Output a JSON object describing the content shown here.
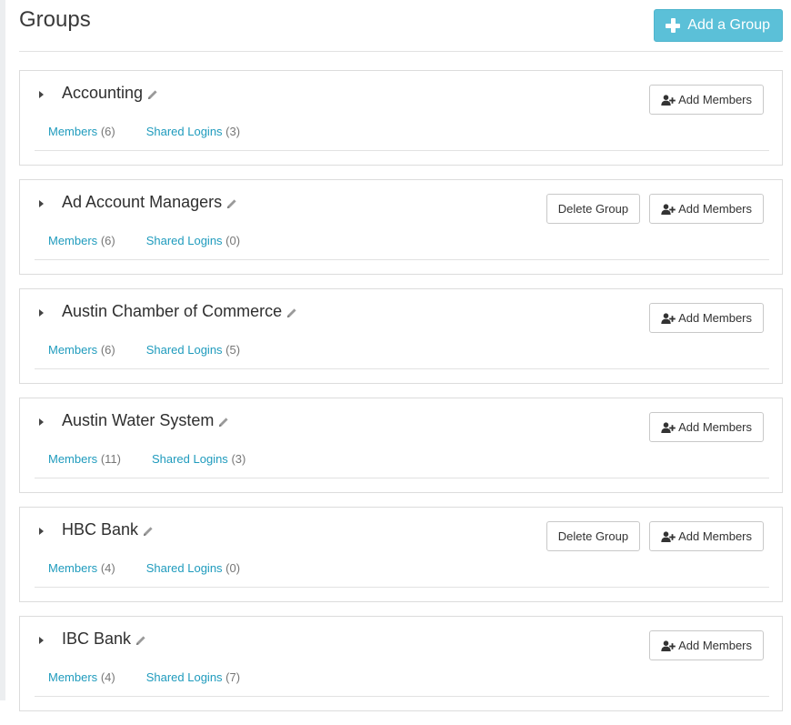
{
  "page": {
    "title": "Groups",
    "add_group_label": "Add a Group"
  },
  "groups": [
    {
      "name": "Accounting",
      "members_label": "Members",
      "members_count": "(6)",
      "logins_label": "Shared Logins",
      "logins_count": "(3)",
      "delete_label": "",
      "add_members_label": "Add Members"
    },
    {
      "name": "Ad Account Managers",
      "members_label": "Members",
      "members_count": "(6)",
      "logins_label": "Shared Logins",
      "logins_count": "(0)",
      "delete_label": "Delete Group",
      "add_members_label": "Add Members"
    },
    {
      "name": "Austin Chamber of Commerce",
      "members_label": "Members",
      "members_count": "(6)",
      "logins_label": "Shared Logins",
      "logins_count": "(5)",
      "delete_label": "",
      "add_members_label": "Add Members"
    },
    {
      "name": "Austin Water System",
      "members_label": "Members",
      "members_count": "(11)",
      "logins_label": "Shared Logins",
      "logins_count": "(3)",
      "delete_label": "",
      "add_members_label": "Add Members"
    },
    {
      "name": "HBC Bank",
      "members_label": "Members",
      "members_count": "(4)",
      "logins_label": "Shared Logins",
      "logins_count": "(0)",
      "delete_label": "Delete Group",
      "add_members_label": "Add Members"
    },
    {
      "name": "IBC Bank",
      "members_label": "Members",
      "members_count": "(4)",
      "logins_label": "Shared Logins",
      "logins_count": "(7)",
      "delete_label": "",
      "add_members_label": "Add Members"
    }
  ],
  "icons": {
    "add_group": "plus-icon",
    "expand": "caret-right-icon",
    "rename": "pencil-icon",
    "add_member": "user-plus-icon"
  },
  "colors": {
    "accent": "#5bc0d8",
    "link": "#1f9bbd",
    "muted": "#777777"
  }
}
